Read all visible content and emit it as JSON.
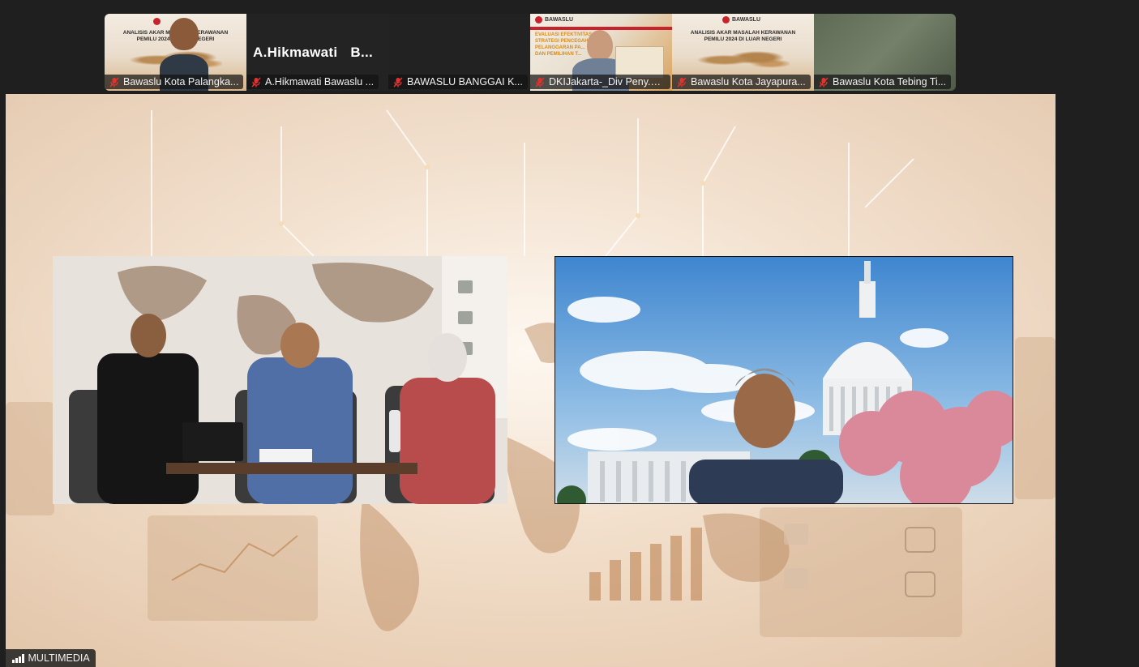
{
  "gallery": {
    "tiles": [
      {
        "name": "Bawaslu Kota Palangka...",
        "muted": true,
        "kind": "banner-person",
        "banner_lines": [
          "ANALISIS AKAR MASALAH KERAWANAN",
          "PEMILU 2024 DI LUAR NEGERI"
        ]
      },
      {
        "name": "A.Hikmawati  Bawaslu ...",
        "muted": true,
        "kind": "name-card",
        "card_name": "A.Hikmawati",
        "card_name_2": "B..."
      },
      {
        "name": "BAWASLU BANGGAI K...",
        "muted": true,
        "kind": "black"
      },
      {
        "name": "DKIJakarta-_Div Peny.S...",
        "muted": true,
        "kind": "presentation",
        "logo_text": "BAWASLU",
        "banner_lines": [
          "EVALUASI EFEKTIVITAS",
          "STRATEGI PENCEGAHAN",
          "PELANGGARAN PA...",
          "DAN PEMILIHAN T..."
        ]
      },
      {
        "name": "Bawaslu Kota Jayapura...",
        "muted": true,
        "kind": "banner",
        "logo_text": "BAWASLU",
        "banner_lines": [
          "ANALISIS AKAR MASALAH KERAWANAN",
          "PEMILU 2024 DI LUAR NEGERI"
        ]
      },
      {
        "name": "Bawaslu Kota Tebing Ti...",
        "muted": true,
        "kind": "blur"
      }
    ]
  },
  "stage": {
    "badge_label": "MULTIMEDIA",
    "signal_bars": 4
  },
  "colors": {
    "muted_icon": "#e0332e",
    "background": "#1f1f1f"
  }
}
